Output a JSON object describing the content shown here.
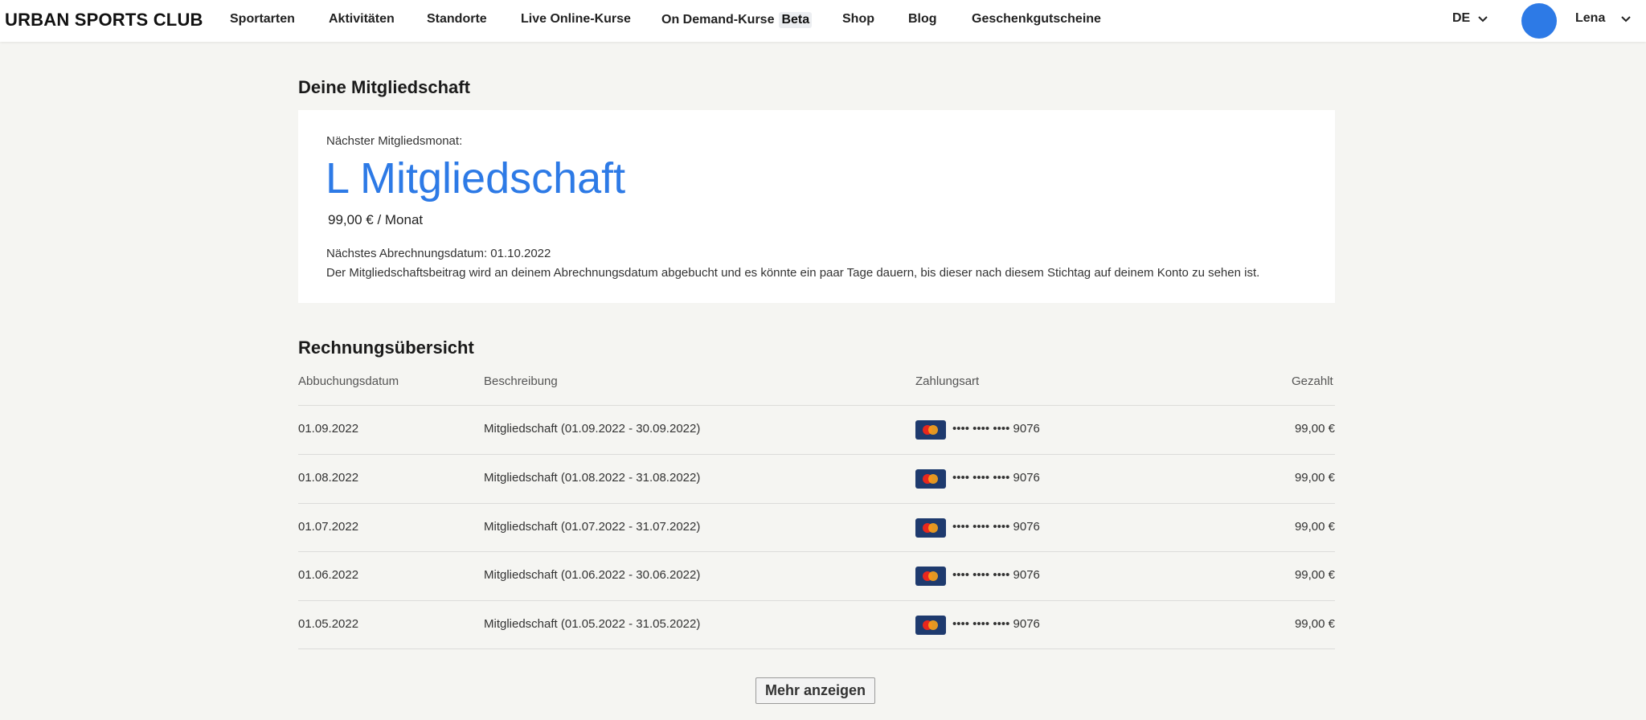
{
  "header": {
    "logo": "URBAN SPORTS CLUB",
    "nav": [
      {
        "label": "Sportarten"
      },
      {
        "label": "Aktivitäten"
      },
      {
        "label": "Standorte"
      },
      {
        "label": "Live Online-Kurse"
      },
      {
        "label": "On Demand-Kurse",
        "badge": "Beta"
      },
      {
        "label": "Shop"
      },
      {
        "label": "Blog"
      },
      {
        "label": "Geschenkgutscheine"
      }
    ],
    "language": "DE",
    "user_name": "Lena",
    "avatar_color": "#2d7ae6"
  },
  "membership": {
    "title": "Deine Mitgliedschaft",
    "next_month_label": "Nächster Mitgliedsmonat:",
    "plan_name": "L Mitgliedschaft",
    "price": "99,00 € / Monat",
    "billing_date": "Nächstes Abrechnungsdatum: 01.10.2022",
    "billing_note": "Der Mitgliedschaftsbeitrag wird an deinem Abrechnungsdatum abgebucht und es könnte ein paar Tage dauern, bis dieser nach diesem Stichtag auf deinem Konto zu sehen ist.",
    "accent_color": "#2d7ae6"
  },
  "invoices": {
    "title": "Rechnungsübersicht",
    "columns": {
      "date": "Abbuchungsdatum",
      "description": "Beschreibung",
      "payment": "Zahlungsart",
      "paid": "Gezahlt"
    },
    "rows": [
      {
        "date": "01.09.2022",
        "description": "Mitgliedschaft (01.09.2022 - 30.09.2022)",
        "card_icon": "mastercard-icon",
        "card": "•••• •••• •••• 9076",
        "amount": "99,00 €"
      },
      {
        "date": "01.08.2022",
        "description": "Mitgliedschaft (01.08.2022 - 31.08.2022)",
        "card_icon": "mastercard-icon",
        "card": "•••• •••• •••• 9076",
        "amount": "99,00 €"
      },
      {
        "date": "01.07.2022",
        "description": "Mitgliedschaft (01.07.2022 - 31.07.2022)",
        "card_icon": "mastercard-icon",
        "card": "•••• •••• •••• 9076",
        "amount": "99,00 €"
      },
      {
        "date": "01.06.2022",
        "description": "Mitgliedschaft (01.06.2022 - 30.06.2022)",
        "card_icon": "mastercard-icon",
        "card": "•••• •••• •••• 9076",
        "amount": "99,00 €"
      },
      {
        "date": "01.05.2022",
        "description": "Mitgliedschaft (01.05.2022 - 31.05.2022)",
        "card_icon": "mastercard-icon",
        "card": "•••• •••• •••• 9076",
        "amount": "99,00 €"
      }
    ],
    "more_button": "Mehr anzeigen"
  }
}
